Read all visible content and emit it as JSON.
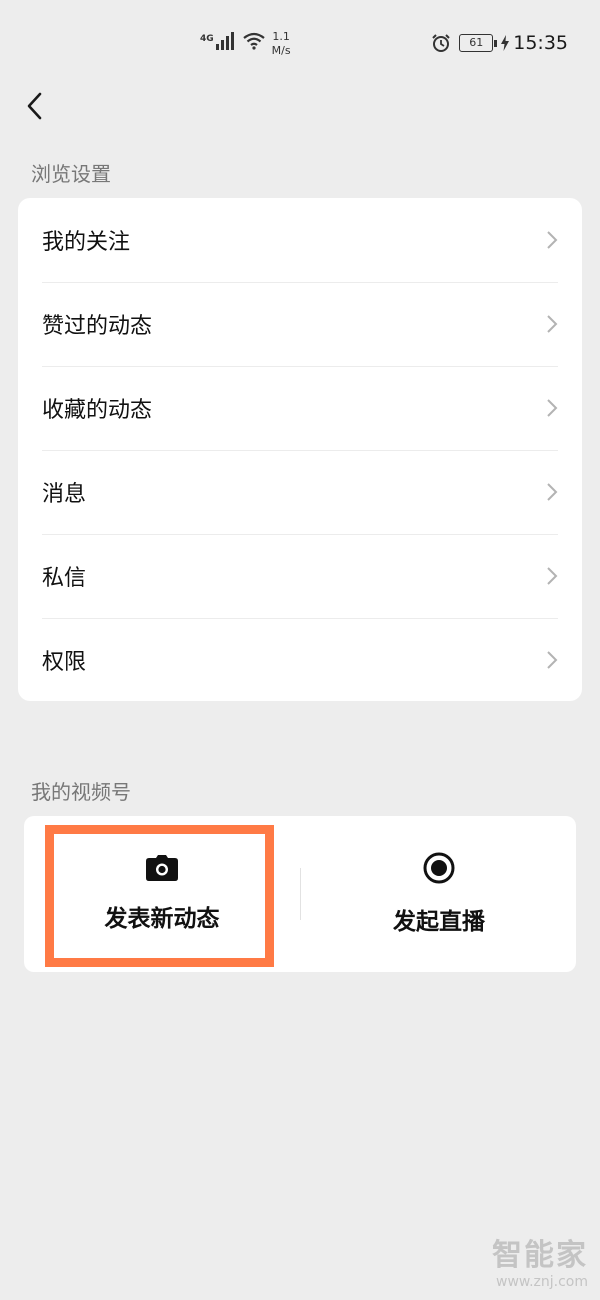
{
  "status_bar": {
    "network": "4G",
    "speed_value": "1.1",
    "speed_unit": "M/s",
    "battery": "61",
    "time": "15:35"
  },
  "browse_section": {
    "title": "浏览设置",
    "items": [
      {
        "label": "我的关注"
      },
      {
        "label": "赞过的动态"
      },
      {
        "label": "收藏的动态"
      },
      {
        "label": "消息"
      },
      {
        "label": "私信"
      },
      {
        "label": "权限"
      }
    ]
  },
  "channel_section": {
    "title": "我的视频号",
    "post_label": "发表新动态",
    "live_label": "发起直播"
  },
  "watermark": {
    "logo": "智能家",
    "url": "www.znj.com"
  },
  "colors": {
    "background": "#ededed",
    "card": "#ffffff",
    "highlight": "#ff7a45"
  },
  "icons": [
    "back-icon",
    "chevron-right-icon",
    "camera-icon",
    "live-record-icon",
    "alarm-icon",
    "wifi-icon",
    "signal-icon",
    "battery-icon",
    "charging-icon"
  ]
}
